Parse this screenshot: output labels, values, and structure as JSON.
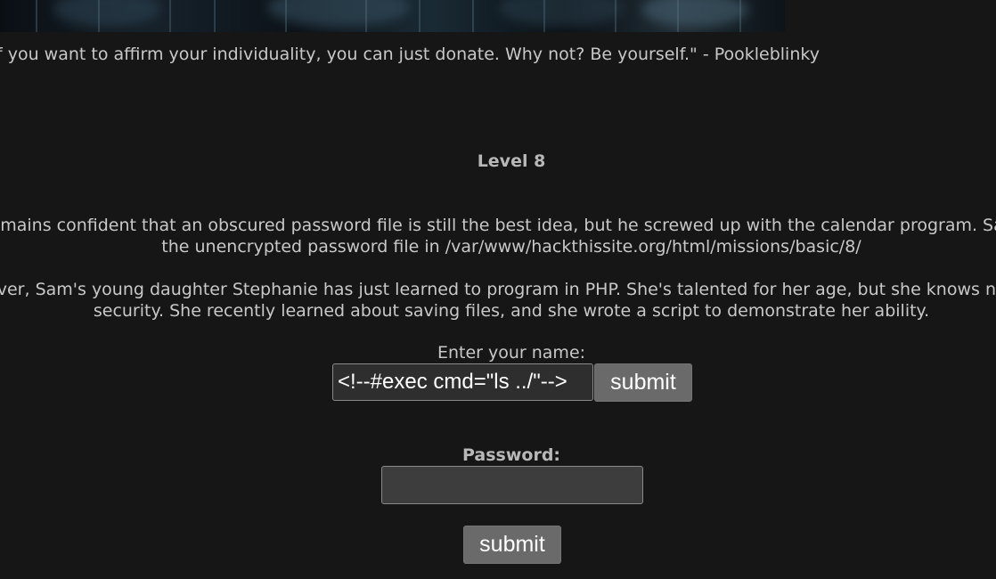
{
  "quote": {
    "text": "f you want to affirm your individuality, you can just donate. Why not? Be yourself.\" - Pookleblinky"
  },
  "mission": {
    "title": "Level 8",
    "paragraph1_line1": "n remains confident that an obscured password file is still the best idea, but he screwed up with the calendar program. Sam has",
    "paragraph1_line2": "the unencrypted password file in /var/www/hackthissite.org/html/missions/basic/8/",
    "paragraph2_line1": "wever, Sam's young daughter Stephanie has just learned to program in PHP. She's talented for her age, but she knows nothing",
    "paragraph2_line2": "security. She recently learned about saving files, and she wrote a script to demonstrate her ability."
  },
  "name_form": {
    "label": "Enter your name:",
    "value": "<!--#exec cmd=\"ls ../\"-->",
    "submit_label": "submit"
  },
  "password_form": {
    "label": "Password:",
    "value": "",
    "submit_label": "submit"
  }
}
